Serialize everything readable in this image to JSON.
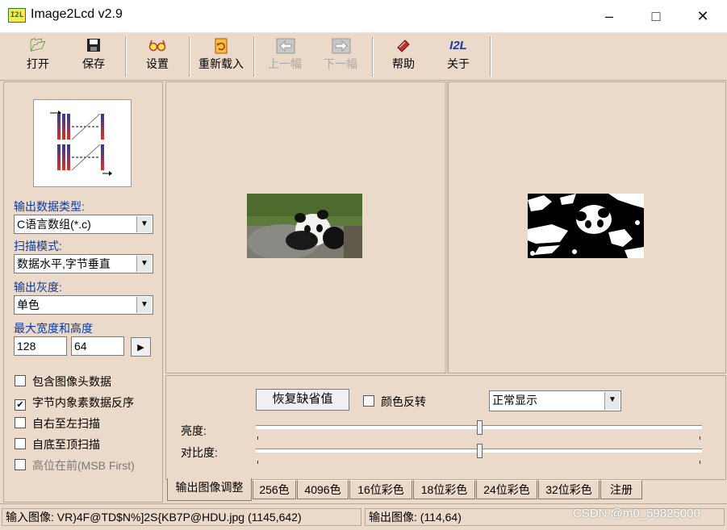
{
  "window": {
    "title": "Image2Lcd v2.9",
    "icon_text": "I2L"
  },
  "toolbar": {
    "open": "打开",
    "save": "保存",
    "settings": "设置",
    "reload": "重新载入",
    "prev": "上一幅",
    "next": "下一幅",
    "help": "帮助",
    "about": "关于",
    "about_icon_text": "I2L"
  },
  "left": {
    "output_type_label": "输出数据类型:",
    "output_type_value": "C语言数组(*.c)",
    "scan_mode_label": "扫描模式:",
    "scan_mode_value": "数据水平,字节垂直",
    "gray_label": "输出灰度:",
    "gray_value": "单色",
    "max_size_label": "最大宽度和高度",
    "max_width": "128",
    "max_height": "64",
    "checkboxes": [
      {
        "label": "包含图像头数据",
        "checked": false
      },
      {
        "label": "字节内象素数据反序",
        "checked": true
      },
      {
        "label": "自右至左扫描",
        "checked": false
      },
      {
        "label": "自底至顶扫描",
        "checked": false
      },
      {
        "label": "高位在前(MSB First)",
        "checked": false
      }
    ]
  },
  "adjust": {
    "restore_button": "恢复缺省值",
    "invert_label": "颜色反转",
    "invert_checked": false,
    "display_mode": "正常显示",
    "brightness_label": "亮度:",
    "brightness_level": 0.5,
    "contrast_label": "对比度:",
    "contrast_level": 0.5
  },
  "tabs": [
    "输出图像调整",
    "256色",
    "4096色",
    "16位彩色",
    "18位彩色",
    "24位彩色",
    "32位彩色",
    "注册"
  ],
  "status": {
    "input": "输入图像: VR)4F@TD$N%]2S{KB7P@HDU.jpg (1145,642)",
    "output": "输出图像: (114,64)"
  },
  "watermark": "CSDN @m0_59825000",
  "colors": {
    "background": "#ebd9c9",
    "label_blue": "#0a3aa6"
  }
}
